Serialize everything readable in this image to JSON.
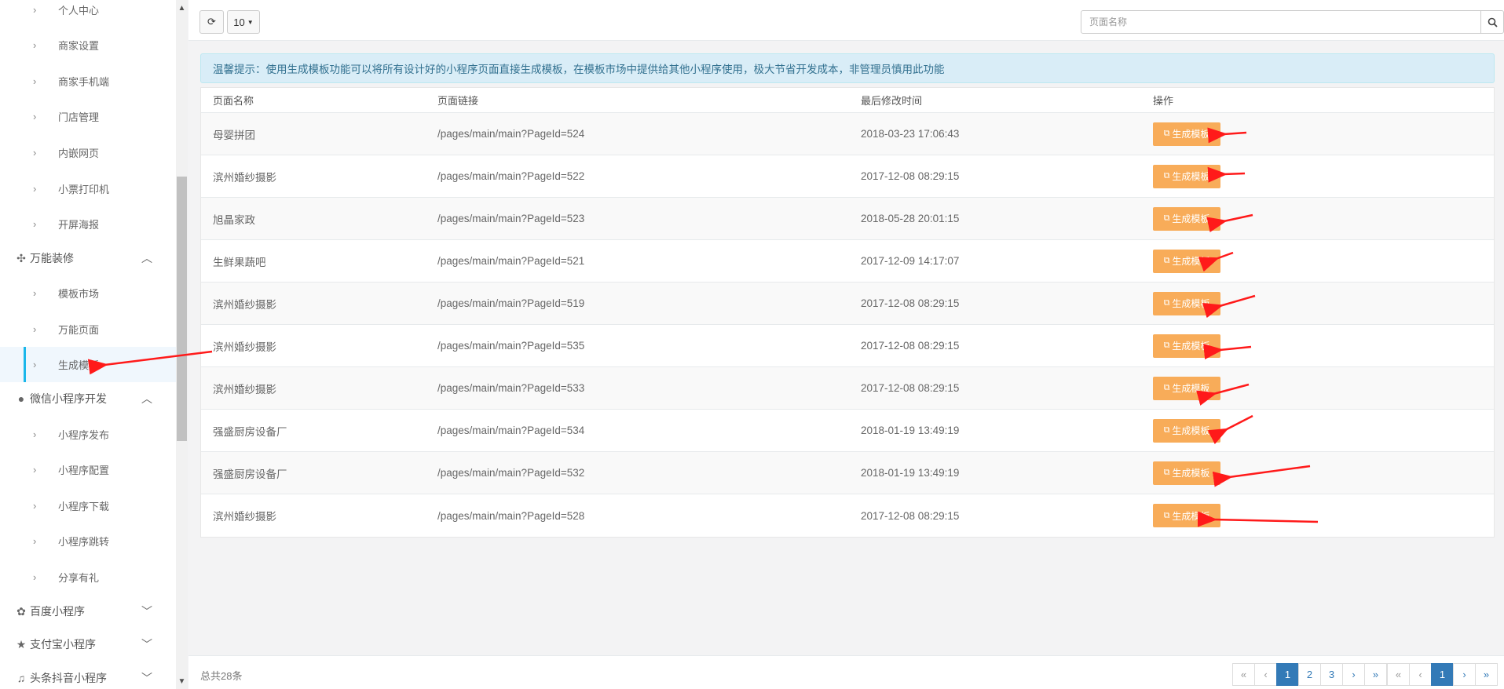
{
  "sidebar": {
    "top_items": [
      {
        "label": "个人中心"
      },
      {
        "label": "商家设置"
      },
      {
        "label": "商家手机端"
      },
      {
        "label": "门店管理"
      },
      {
        "label": "内嵌网页"
      },
      {
        "label": "小票打印机"
      },
      {
        "label": "开屏海报"
      }
    ],
    "group_wanneng": {
      "label": "万能装修",
      "icon": "arrows-icon",
      "expanded": true
    },
    "wanneng_items": [
      {
        "label": "模板市场"
      },
      {
        "label": "万能页面"
      },
      {
        "label": "生成模板",
        "active": true
      }
    ],
    "group_wechat": {
      "label": "微信小程序开发",
      "icon": "wechat-icon",
      "expanded": true
    },
    "wechat_items": [
      {
        "label": "小程序发布"
      },
      {
        "label": "小程序配置"
      },
      {
        "label": "小程序下载"
      },
      {
        "label": "小程序跳转"
      },
      {
        "label": "分享有礼"
      }
    ],
    "group_baidu": {
      "label": "百度小程序",
      "icon": "paw-icon",
      "expanded": false
    },
    "group_alipay": {
      "label": "支付宝小程序",
      "icon": "star-icon",
      "expanded": false
    },
    "group_toutiao": {
      "label": "头条抖音小程序",
      "icon": "music-icon",
      "expanded": false
    }
  },
  "toolbar": {
    "page_size": "10",
    "search_placeholder": "页面名称"
  },
  "alert": {
    "text": "温馨提示：使用生成模板功能可以将所有设计好的小程序页面直接生成模板，在模板市场中提供给其他小程序使用，极大节省开发成本，非管理员慎用此功能"
  },
  "table": {
    "headers": [
      "页面名称",
      "页面链接",
      "最后修改时间",
      "操作"
    ],
    "action_label": "生成模板",
    "rows": [
      {
        "name": "母婴拼团",
        "link": "/pages/main/main?PageId=524",
        "time": "2018-03-23 17:06:43"
      },
      {
        "name": "滨州婚纱摄影",
        "link": "/pages/main/main?PageId=522",
        "time": "2017-12-08 08:29:15"
      },
      {
        "name": "旭晶家政",
        "link": "/pages/main/main?PageId=523",
        "time": "2018-05-28 20:01:15"
      },
      {
        "name": "生鲜果蔬吧",
        "link": "/pages/main/main?PageId=521",
        "time": "2017-12-09 14:17:07"
      },
      {
        "name": "滨州婚纱摄影",
        "link": "/pages/main/main?PageId=519",
        "time": "2017-12-08 08:29:15"
      },
      {
        "name": "滨州婚纱摄影",
        "link": "/pages/main/main?PageId=535",
        "time": "2017-12-08 08:29:15"
      },
      {
        "name": "滨州婚纱摄影",
        "link": "/pages/main/main?PageId=533",
        "time": "2017-12-08 08:29:15"
      },
      {
        "name": "强盛厨房设备厂",
        "link": "/pages/main/main?PageId=534",
        "time": "2018-01-19 13:49:19"
      },
      {
        "name": "强盛厨房设备厂",
        "link": "/pages/main/main?PageId=532",
        "time": "2018-01-19 13:49:19"
      },
      {
        "name": "滨州婚纱摄影",
        "link": "/pages/main/main?PageId=528",
        "time": "2017-12-08 08:29:15"
      }
    ]
  },
  "footer": {
    "total_text": "总共28条",
    "pager1": [
      "«",
      "‹",
      "1",
      "2",
      "3",
      "›",
      "»"
    ],
    "pager1_active": "1",
    "pager2": [
      "«",
      "‹",
      "1",
      "›",
      "»"
    ],
    "pager2_active": "1"
  },
  "colors": {
    "accent_button": "#f8ac59",
    "active_page": "#337ab7",
    "alert_bg": "#d9edf7",
    "annotation_arrow": "#ff1a1a"
  }
}
